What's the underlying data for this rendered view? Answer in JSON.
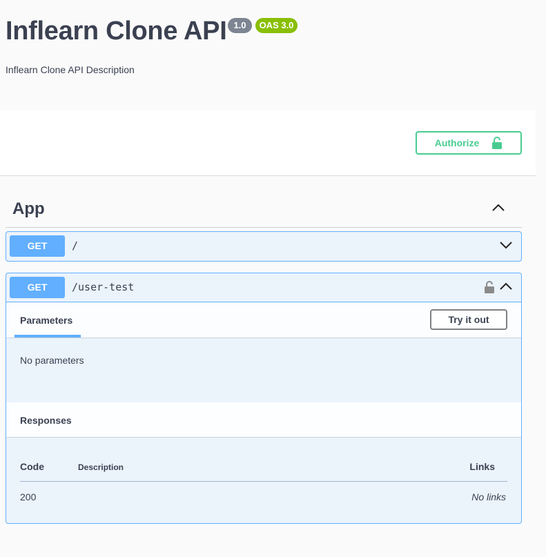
{
  "info": {
    "title": "Inflearn Clone API",
    "version": "1.0",
    "oas_badge": "OAS 3.0",
    "description": "Inflearn Clone API Description"
  },
  "authorize": {
    "label": "Authorize",
    "icon": "unlock-icon",
    "color": "#49cc90"
  },
  "tag": {
    "name": "App",
    "state": "expanded"
  },
  "operations": [
    {
      "method": "GET",
      "path": "/",
      "state": "collapsed"
    },
    {
      "method": "GET",
      "path": "/user-test",
      "state": "expanded",
      "parameters_tab": "Parameters",
      "try_it_out_label": "Try it out",
      "no_parameters_text": "No parameters",
      "responses_title": "Responses",
      "responses_columns": {
        "code": "Code",
        "description": "Description",
        "links": "Links"
      },
      "responses": [
        {
          "code": "200",
          "description": "",
          "links": "No links"
        }
      ]
    }
  ],
  "colors": {
    "get_method": "#61affe",
    "get_bg": "#ebf3fb",
    "text": "#3b4151"
  }
}
